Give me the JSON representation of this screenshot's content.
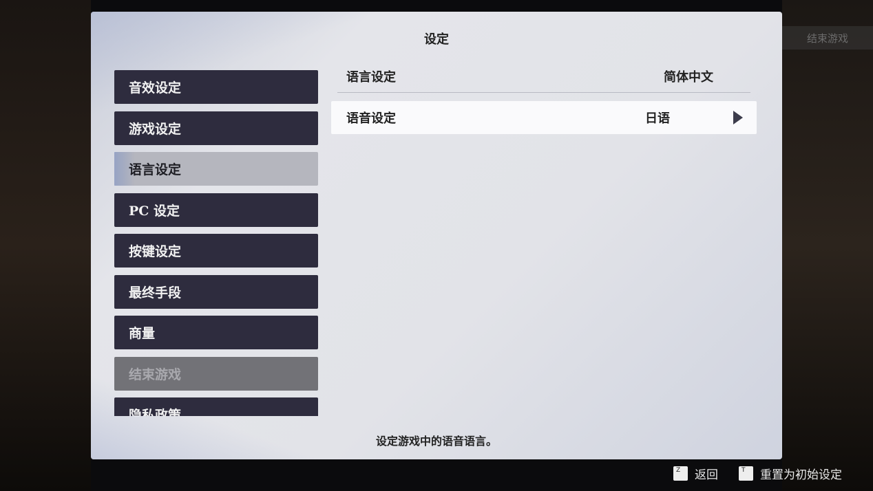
{
  "background": {
    "end_game": "结束游戏"
  },
  "title": "设定",
  "menu": [
    {
      "label": "音效设定"
    },
    {
      "label": "游戏设定"
    },
    {
      "label": "语言设定",
      "selected": true
    },
    {
      "label": "PC 设定"
    },
    {
      "label": "按键设定"
    },
    {
      "label": "最终手段"
    },
    {
      "label": "商量"
    },
    {
      "label": "结束游戏",
      "disabled": true
    },
    {
      "label": "隐私政策"
    }
  ],
  "settings": [
    {
      "label": "语言设定",
      "value": "简体中文"
    },
    {
      "label": "语音设定",
      "value": "日语"
    }
  ],
  "description": "设定游戏中的语音语言。",
  "footer": {
    "back_key": "Z",
    "back_label": "返回",
    "reset_key": "T",
    "reset_label": "重置为初始设定"
  }
}
